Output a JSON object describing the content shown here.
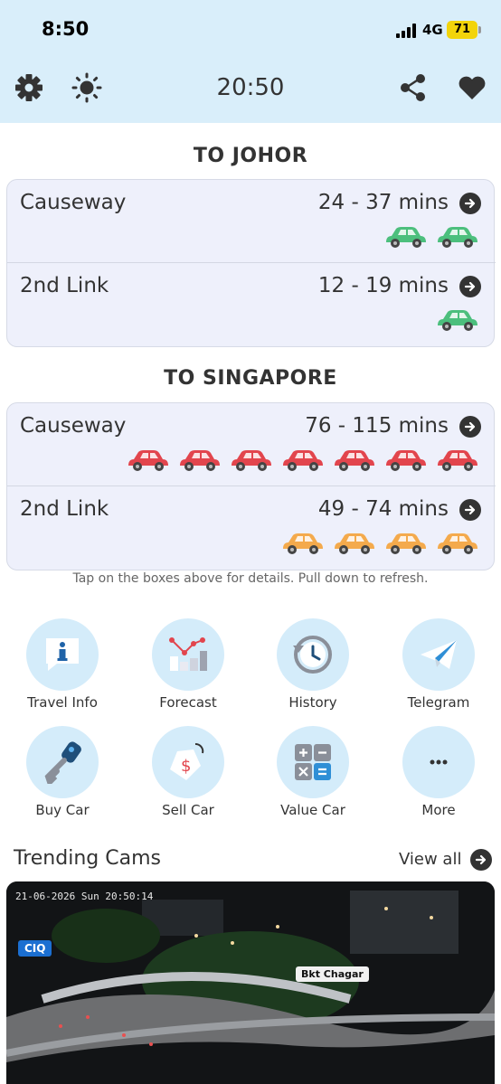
{
  "status_bar": {
    "time": "8:50",
    "network": "4G",
    "battery": "71"
  },
  "header": {
    "time": "20:50",
    "icons": [
      "settings-icon",
      "brightness-icon",
      "share-icon",
      "heart-icon"
    ]
  },
  "to_johor": {
    "title": "TO JOHOR",
    "routes": [
      {
        "name": "Causeway",
        "time": "24 - 37 mins",
        "cars": 2,
        "car_color": "#4cbf7d"
      },
      {
        "name": "2nd Link",
        "time": "12 - 19 mins",
        "cars": 1,
        "car_color": "#4cbf7d"
      }
    ]
  },
  "to_singapore": {
    "title": "TO SINGAPORE",
    "routes": [
      {
        "name": "Causeway",
        "time": "76 - 115 mins",
        "cars": 7,
        "car_color": "#e2454d"
      },
      {
        "name": "2nd Link",
        "time": "49 - 74 mins",
        "cars": 4,
        "car_color": "#f4aa4c"
      }
    ]
  },
  "hint": "Tap on the boxes above for details. Pull down to refresh.",
  "menu": [
    {
      "label": "Travel Info",
      "icon": "info-bubble-icon"
    },
    {
      "label": "Forecast",
      "icon": "chart-icon"
    },
    {
      "label": "History",
      "icon": "history-icon"
    },
    {
      "label": "Telegram",
      "icon": "telegram-icon"
    },
    {
      "label": "Buy Car",
      "icon": "car-key-icon"
    },
    {
      "label": "Sell Car",
      "icon": "price-tag-icon"
    },
    {
      "label": "Value Car",
      "icon": "calculator-icon"
    },
    {
      "label": "More",
      "icon": "more-icon"
    }
  ],
  "trending": {
    "title": "Trending Cams",
    "view_all": "View all",
    "cam": {
      "timestamp": "21-06-2026 Sun 20:50:14",
      "tag": "CIQ",
      "location_tag": "Bkt Chagar"
    }
  }
}
